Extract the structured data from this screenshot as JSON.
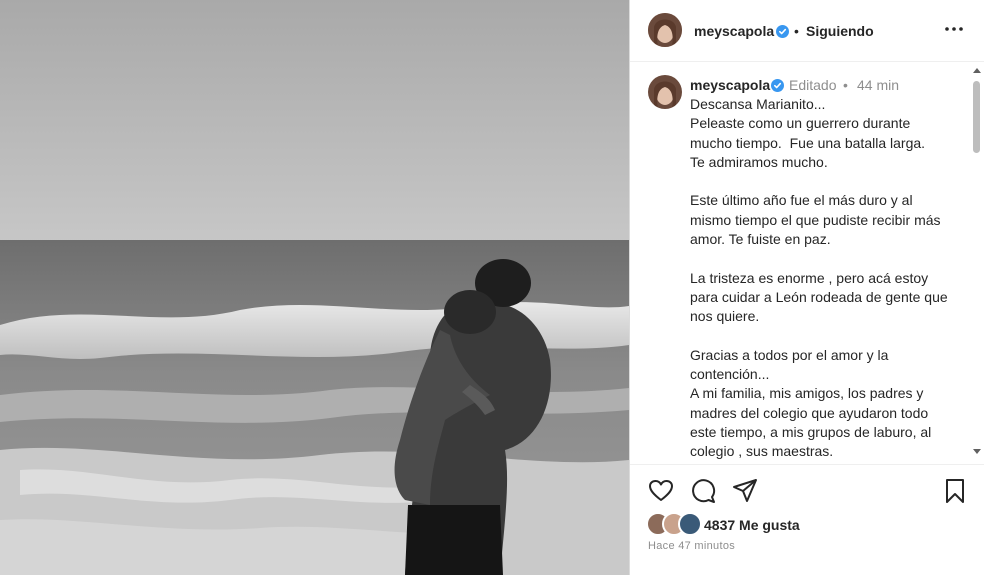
{
  "post": {
    "image_alt": "Foto en blanco y negro: hombre cargando a un niño frente al mar"
  },
  "header": {
    "username": "meyscapola",
    "separator": "•",
    "follow_status": "Siguiendo"
  },
  "caption": {
    "username": "meyscapola",
    "edited": "Editado",
    "separator": "•",
    "time_ago": "44 min",
    "text": "Descansa Marianito...\nPeleaste como un guerrero durante mucho tiempo.  Fue una batalla larga.\nTe admiramos mucho.\n\nEste último año fue el más duro y al mismo tiempo el que pudiste recibir más amor. Te fuiste en paz.\n\nLa tristeza es enorme , pero acá estoy para cuidar a León rodeada de gente que nos quiere.\n\nGracias a todos por el amor y la contención...\nA mi familia, mis amigos, los padres y madres del colegio que ayudaron todo este tiempo, a mis grupos de laburo, al colegio , sus maestras.\nGracias infinitas a mis amigos..."
  },
  "actions": {
    "icons": [
      "heart-icon",
      "comment-icon",
      "share-icon",
      "save-icon"
    ]
  },
  "likes": {
    "count_text": "4837 Me gusta"
  },
  "timestamp": "Hace 47 minutos",
  "colors": {
    "verified": "#3897f0",
    "text": "#262626",
    "muted": "#8e8e8e"
  }
}
